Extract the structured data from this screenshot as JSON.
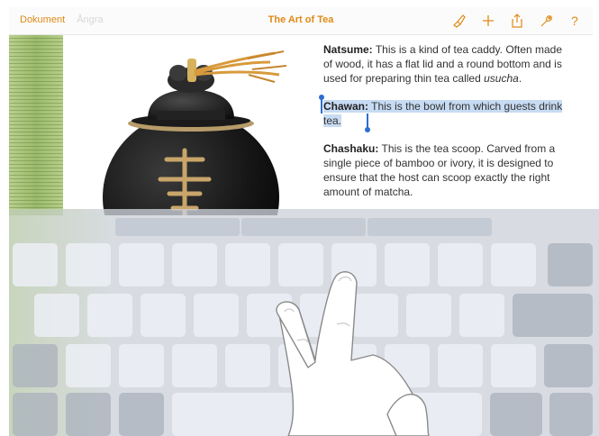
{
  "toolbar": {
    "document_label": "Dokument",
    "undo_label": "Ångra",
    "title": "The Art of Tea",
    "accent_color": "#e08a16",
    "icons": [
      "brush-icon",
      "plus-icon",
      "share-icon",
      "wrench-icon",
      "help-icon"
    ]
  },
  "document": {
    "image": "tea-caddy-photo",
    "paragraphs": [
      {
        "term": "Natsume:",
        "body": "This is a kind of tea caddy. Often made of wood, it has a flat lid and a round bottom and is used for preparing thin tea called",
        "emphasis": "usucha",
        "tail": "."
      },
      {
        "term": "Chawan:",
        "body": "This is the bowl from which guests drink tea.",
        "selected": true
      },
      {
        "term": "Chashaku:",
        "body": "This is the tea scoop. Carved from a single piece of bamboo or ivory, it is designed to ensure that the host can scoop exactly the right amount of matcha."
      }
    ]
  },
  "keyboard": {
    "mode": "trackpad",
    "gesture": "two-finger-hand"
  }
}
